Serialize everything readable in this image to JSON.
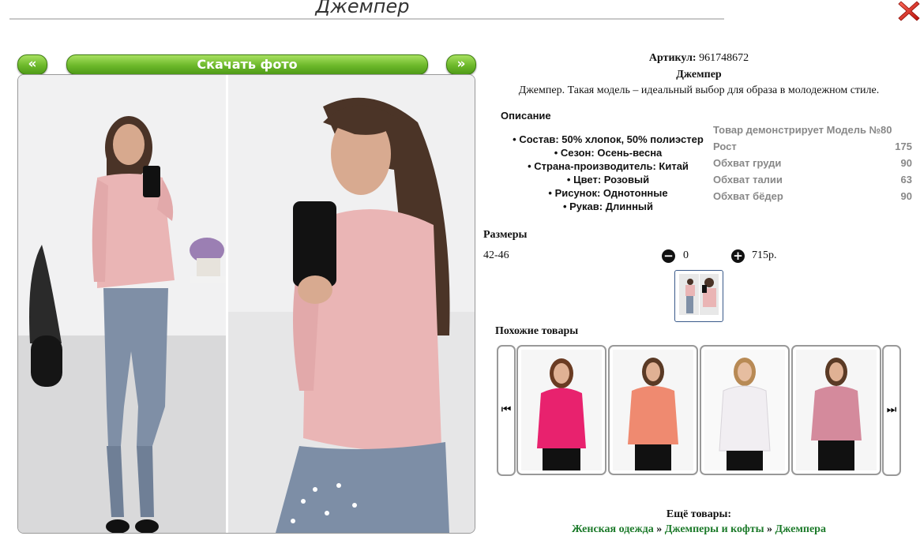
{
  "page": {
    "title": "Джемпер"
  },
  "gallery": {
    "prev_label": "«",
    "next_label": "»",
    "download_label": "Скачать фото"
  },
  "product": {
    "sku_label": "Артикул:",
    "sku_value": "961748672",
    "name": "Джемпер",
    "tagline": "Джемпер. Такая модель – идеальный выбор для образа в молодежном стиле."
  },
  "description": {
    "heading": "Описание",
    "properties": [
      "Состав: 50% хлопок, 50% полиэстер",
      "Сезон: Осень-весна",
      "Страна-производитель: Китай",
      "Цвет: Розовый",
      "Рисунок: Однотонные",
      "Рукав: Длинный"
    ]
  },
  "model": {
    "heading": "Товар демонстрирует Модель №80",
    "rows": [
      {
        "label": "Рост",
        "value": "175"
      },
      {
        "label": "Обхват груди",
        "value": "90"
      },
      {
        "label": "Обхват талии",
        "value": "63"
      },
      {
        "label": "Обхват бёдер",
        "value": "90"
      }
    ]
  },
  "sizes": {
    "heading": "Размеры",
    "items": [
      {
        "size": "42-46",
        "quantity": "0",
        "price": "715р."
      }
    ]
  },
  "similar": {
    "heading": "Похожие товары",
    "colors": [
      "#e8226e",
      "#ef8a70",
      "#f1eef2",
      "#d48a9c"
    ]
  },
  "more": {
    "heading": "Ещё товары:",
    "crumbs": [
      "Женская одежда",
      "Джемперы и кофты",
      "Джемпера"
    ],
    "separator": "»"
  },
  "colors": {
    "accent_green": "#6cb82a",
    "link_green": "#1c7a2a",
    "sweater_pink": "#eab5b5"
  }
}
